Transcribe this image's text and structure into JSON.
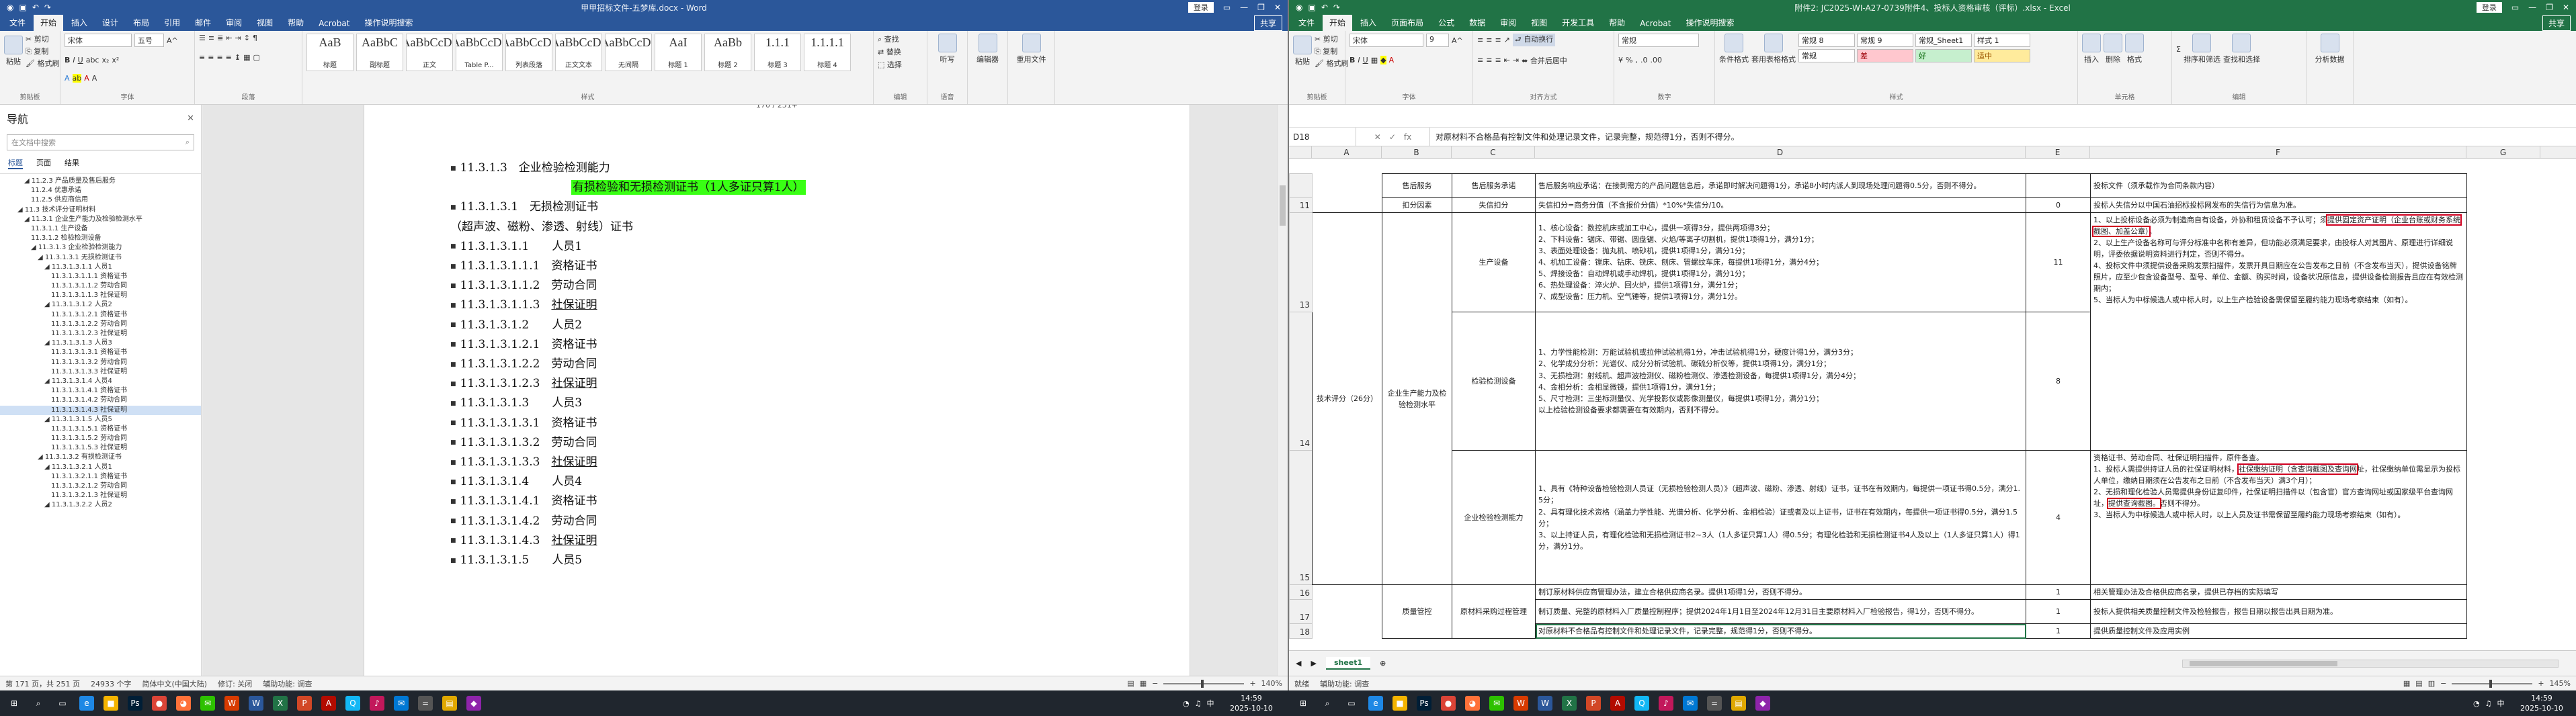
{
  "word": {
    "title": "甲甲招标文件-五梦库.docx - Word",
    "login": "登录",
    "share": "共享",
    "tabs": [
      "文件",
      "开始",
      "插入",
      "设计",
      "布局",
      "引用",
      "邮件",
      "审阅",
      "视图",
      "帮助",
      "Acrobat",
      "操作说明搜索"
    ],
    "ribbon": {
      "paste": "粘贴",
      "cut": "剪切",
      "copy": "复制",
      "format_painter": "格式刷",
      "clipboard": "剪贴板",
      "font_name": "宋体",
      "font_size": "五号",
      "font_group": "字体",
      "para_group": "段落",
      "styles_group": "样式",
      "styles": [
        {
          "sample": "AaB",
          "name": "标题"
        },
        {
          "sample": "AaBbC",
          "name": "副标题"
        },
        {
          "sample": "AaBbCcDc",
          "name": "正文"
        },
        {
          "sample": "AaBbCcDc",
          "name": "Table P..."
        },
        {
          "sample": "AaBbCcDc",
          "name": "列表段落"
        },
        {
          "sample": "AaBbCcDc",
          "name": "正文文本"
        },
        {
          "sample": "AaBbCcDc",
          "name": "无间隔"
        },
        {
          "sample": "AaI",
          "name": "标题 1"
        },
        {
          "sample": "AaBb",
          "name": "标题 2"
        },
        {
          "sample": "1.1.1",
          "name": "标题 3"
        },
        {
          "sample": "1.1.1.1",
          "name": "标题 4"
        }
      ],
      "find": "查找",
      "replace": "替换",
      "select": "选择",
      "edit_group": "编辑",
      "dictate": "听写",
      "voice_group": "语音",
      "editor": "编辑器",
      "reuse": "重用文件"
    },
    "nav": {
      "title": "导航",
      "search_placeholder": "在文档中搜索",
      "tabs": [
        "标题",
        "页面",
        "结果"
      ],
      "items": [
        {
          "indent": 3,
          "text": "◢ 11.2.3 产品质量及售后服务"
        },
        {
          "indent": 4,
          "text": "11.2.4 优惠承诺"
        },
        {
          "indent": 4,
          "text": "11.2.5 供应商信用"
        },
        {
          "indent": 2,
          "text": "◢ 11.3 技术评分证明材料"
        },
        {
          "indent": 3,
          "text": "◢ 11.3.1 企业生产能力及检验检测水平"
        },
        {
          "indent": 4,
          "text": "11.3.1.1 生产设备"
        },
        {
          "indent": 4,
          "text": "11.3.1.2 检验检测设备"
        },
        {
          "indent": 4,
          "text": "◢ 11.3.1.3 企业检验检测能力"
        },
        {
          "indent": 5,
          "text": "◢ 11.3.1.3.1 无损检测证书"
        },
        {
          "indent": 6,
          "text": "◢ 11.3.1.3.1.1 人员1"
        },
        {
          "indent": 7,
          "text": "11.3.1.3.1.1.1 资格证书"
        },
        {
          "indent": 7,
          "text": "11.3.1.3.1.1.2 劳动合同"
        },
        {
          "indent": 7,
          "text": "11.3.1.3.1.1.3 社保证明"
        },
        {
          "indent": 6,
          "text": "◢ 11.3.1.3.1.2 人员2"
        },
        {
          "indent": 7,
          "text": "11.3.1.3.1.2.1 资格证书"
        },
        {
          "indent": 7,
          "text": "11.3.1.3.1.2.2 劳动合同"
        },
        {
          "indent": 7,
          "text": "11.3.1.3.1.2.3 社保证明"
        },
        {
          "indent": 6,
          "text": "◢ 11.3.1.3.1.3 人员3"
        },
        {
          "indent": 7,
          "text": "11.3.1.3.1.3.1 资格证书"
        },
        {
          "indent": 7,
          "text": "11.3.1.3.1.3.2 劳动合同"
        },
        {
          "indent": 7,
          "text": "11.3.1.3.1.3.3 社保证明"
        },
        {
          "indent": 6,
          "text": "◢ 11.3.1.3.1.4 人员4"
        },
        {
          "indent": 7,
          "text": "11.3.1.3.1.4.1 资格证书"
        },
        {
          "indent": 7,
          "text": "11.3.1.3.1.4.2 劳动合同"
        },
        {
          "indent": 7,
          "text": "11.3.1.3.1.4.3 社保证明",
          "sel": true
        },
        {
          "indent": 6,
          "text": "◢ 11.3.1.3.1.5 人员5"
        },
        {
          "indent": 7,
          "text": "11.3.1.3.1.5.1 资格证书"
        },
        {
          "indent": 7,
          "text": "11.3.1.3.1.5.2 劳动合同"
        },
        {
          "indent": 7,
          "text": "11.3.1.3.1.5.3 社保证明"
        },
        {
          "indent": 5,
          "text": "◢ 11.3.1.3.2 有损检测证书"
        },
        {
          "indent": 6,
          "text": "◢ 11.3.1.3.2.1 人员1"
        },
        {
          "indent": 7,
          "text": "11.3.1.3.2.1.1 资格证书"
        },
        {
          "indent": 7,
          "text": "11.3.1.3.2.1.2 劳动合同"
        },
        {
          "indent": 7,
          "text": "11.3.1.3.2.1.3 社保证明"
        },
        {
          "indent": 6,
          "text": "◢ 11.3.1.3.2.2 人员2"
        }
      ]
    },
    "page_number": "170 / 251+",
    "doc_lines": [
      {
        "text": "11.3.1.3　企业检验检测能力",
        "indent": 0
      },
      {
        "text": "有损检验和无损检测证书（1人多证只算1人）",
        "indent": 2,
        "highlight": true,
        "nobullet": true
      },
      {
        "text": "11.3.1.3.1　无损检测证书",
        "indent": 0
      },
      {
        "text": "（超声波、磁粉、渗透、射线）证书",
        "indent": 0,
        "nobullet": true
      },
      {
        "text": "11.3.1.3.1.1　　人员1",
        "indent": 0
      },
      {
        "text": "11.3.1.3.1.1.1　资格证书",
        "indent": 0
      },
      {
        "text": "11.3.1.3.1.1.2　劳动合同",
        "indent": 0
      },
      {
        "text": "11.3.1.3.1.1.3　",
        "indent": 0,
        "u": "社保证明"
      },
      {
        "text": "11.3.1.3.1.2　　人员2",
        "indent": 0
      },
      {
        "text": "11.3.1.3.1.2.1　资格证书",
        "indent": 0
      },
      {
        "text": "11.3.1.3.1.2.2　劳动合同",
        "indent": 0
      },
      {
        "text": "11.3.1.3.1.2.3　",
        "indent": 0,
        "u": "社保证明"
      },
      {
        "text": "11.3.1.3.1.3　　人员3",
        "indent": 0
      },
      {
        "text": "11.3.1.3.1.3.1　资格证书",
        "indent": 0
      },
      {
        "text": "11.3.1.3.1.3.2　劳动合同",
        "indent": 0
      },
      {
        "text": "11.3.1.3.1.3.3　",
        "indent": 0,
        "u": "社保证明"
      },
      {
        "text": "11.3.1.3.1.4　　人员4",
        "indent": 0
      },
      {
        "text": "11.3.1.3.1.4.1　资格证书",
        "indent": 0
      },
      {
        "text": "11.3.1.3.1.4.2　劳动合同",
        "indent": 0
      },
      {
        "text": "11.3.1.3.1.4.3　",
        "indent": 0,
        "u": "社保证明"
      },
      {
        "text": "11.3.1.3.1.5　　人员5",
        "indent": 0
      }
    ],
    "status": {
      "page": "第 171 页，共 251 页",
      "words": "24933 个字",
      "lang": "简体中文(中国大陆)",
      "track": "修订: 关闭",
      "access": "辅助功能: 调查",
      "zoom": "140%"
    }
  },
  "excel": {
    "title": "附件2: JC2025-WI-A27-0739附件4、投标人资格审核（评标）.xlsx - Excel",
    "login": "登录",
    "share": "共享",
    "tabs": [
      "文件",
      "开始",
      "插入",
      "页面布局",
      "公式",
      "数据",
      "审阅",
      "视图",
      "开发工具",
      "帮助",
      "Acrobat",
      "操作说明搜索"
    ],
    "ribbon": {
      "paste": "粘贴",
      "cut": "剪切",
      "copy": "复制",
      "format_painter": "格式刷",
      "clipboard": "剪贴板",
      "font_name": "宋体",
      "font_size": "9",
      "font_group": "字体",
      "wrap": "自动换行",
      "merge": "合并后居中",
      "align_group": "对齐方式",
      "number_format": "常规",
      "number_group": "数字",
      "cond_format": "条件格式",
      "table_format": "套用表格格式",
      "cell_styles": [
        {
          "name": "常规 8",
          "bg": "#ffffff",
          "fg": "#222222"
        },
        {
          "name": "常规 9",
          "bg": "#ffffff",
          "fg": "#222222"
        },
        {
          "name": "常规_Sheet1",
          "bg": "#ffffff",
          "fg": "#222222"
        },
        {
          "name": "样式 1",
          "bg": "#ffffff",
          "fg": "#222222"
        },
        {
          "name": "常规",
          "bg": "#ffffff",
          "fg": "#222222"
        },
        {
          "name": "差",
          "bg": "#ffc7ce",
          "fg": "#9c0006"
        },
        {
          "name": "好",
          "bg": "#c6efce",
          "fg": "#006100"
        },
        {
          "name": "适中",
          "bg": "#ffeb9c",
          "fg": "#9c5700"
        }
      ],
      "styles_group": "样式",
      "insert": "插入",
      "delete": "删除",
      "format": "格式",
      "cells_group": "单元格",
      "sort": "排序和筛选",
      "find": "查找和选择",
      "edit_group": "编辑",
      "ai": "分析数据"
    },
    "name_box": "D18",
    "formula": "对原材料不合格品有控制文件和处理记录文件，记录完整，规范得1分，否则不得分。",
    "columns": [
      "A",
      "B",
      "C",
      "D",
      "E",
      "F",
      "G"
    ],
    "rows": {
      "r10": {
        "num": "",
        "b": "售后服务",
        "c": "售后服务承诺",
        "d": "售后服务响应承诺：在接到需方的产品问题信息后，承诺即时解决问题得1分，承诺8小时内派人到现场处理问题得0.5分，否则不得分。",
        "e": "",
        "f": "投标文件（须承载作为合同条款内容）"
      },
      "r11": {
        "num": "11",
        "b": "扣分因素",
        "c": "失信扣分",
        "d": "失信扣分=商务分值（不含报价分值）*10%*失信分/10。",
        "e": "0",
        "f": "投标人失信分以中国石油招标投标网发布的失信行为信息为准。"
      },
      "r13": {
        "num": "13",
        "c": "生产设备",
        "d": "1、核心设备：数控机床或加工中心，提供一项得3分，提供两项得3分；\n2、下料设备：锯床、带锯、圆盘锯、火焰/等离子切割机，提供1项得1分，满分1分；\n3、表面处理设备：抛丸机、喷砂机，提供1项得1分，满分1分；\n4、机加工设备：镗床、钻床、铣床、刨床、管螺纹车床，每提供1项得1分，满分4分；\n5、焊接设备：自动焊机或手动焊机，提供1项得1分，满分1分；\n6、热处理设备：淬火炉、回火炉，提供1项得1分，满分1分；\n7、成型设备：压力机、空气锤等，提供1项得1分，满分1分。",
        "e": "11",
        "f1": "1、以上投标设备必须为制造商自有设备，外协和租赁设备不予认可；须",
        "f_box1": "提供固定资产证明（企业台账或财务系统截图、加盖公章）",
        "f2": "。\n2、以上生产设备名称可与评分标准中名称有差异，但功能必须满足要求，由投标人对其图片、原理进行详细说明，评委依据说明资料进行判定，否则不得分。"
      },
      "r14": {
        "num": "14",
        "a": "技术评分（26分）",
        "b": "企业生产能力及检验检测水平",
        "c": "检验检测设备",
        "d": "1、力学性能检测：万能试验机或拉伸试验机得1分，冲击试验机得1分，硬度计得1分，满分3分；\n2、化学成分分析：光谱仪、成分分析试验机、碳硫分析仪等，提供1项得1分，满分1分；\n3、无损检测：射线机、超声波检测仪、磁粉检测仪、渗透检测设备，每提供1项得1分，满分4分；\n4、金相分析：金相显微镜，提供1项得1分，满分1分；\n5、尺寸检测：三坐标测量仪、光学投影仪或影像测量仪，每提供1项得1分，满分1分；\n以上检验检测设备要求都需要在有效期内，否则不得分。",
        "e": "8",
        "f": "4、投标文件中须提供设备采购发票扫描件，发票开具日期应在公告发布之日前（不含发布当天），提供设备铭牌照片，应至少包含设备型号、型号、单位、金额、购买时间，设备状况原信息，提供设备检测报告且应在有效检测期内；\n5、当标人为中标候选人或中标人时，以上生产检验设备需保留至履约能力现场考察结束（如有）。"
      },
      "r15": {
        "num": "15",
        "c": "企业检验检测能力",
        "d": "1、具有《特种设备检验检测人员证（无损检验检测人员）》（超声波、磁粉、渗透、射线）证书，证书在有效期内，每提供一项证书得0.5分，满分1.5分；\n2、具有理化技术资格（涵盖力学性能、光谱分析、化学分析、金相检验）证或者及以上证书，证书在有效期内，每提供一项证书得0.5分，满分1.5分；\n3、以上持证人员，有理化检验和无损检测证书2~3人（1人多证只算1人）得0.5分；有理化检验和无损检测证书4人及以上（1人多证只算1人）得1分，满分1分。",
        "e": "4",
        "f1": "资格证书、劳动合同、社保证明扫描件，原件备查。\n1、投标人需提供持证人员的社保证明材料，",
        "f_box1": "社保缴纳证明（含查询截图及查询网",
        "f2": "址，社保缴纳单位需显示为投标人单位，缴纳日期须在公告发布之日前（不含发布当天）满3个月）；\n2、无损和理化检验人员需提供身份证复印件，社保证明扫描件以（包含官）官方查询网址或国家级平台查询网址，",
        "f_box2": "提供查询截图。",
        "f3": "否则不得分。\n3、当标人为中标候选人或中标人时，以上人员及证书需保留至履约能力现场考察结束（如有）。"
      },
      "r16": {
        "num": "16",
        "d": "制订原材料供应商管理办法，建立合格供应商名录。提供1项得1分，否则不得分。",
        "e": "1",
        "f": "相关管理办法及合格供应商名录，提供已存档的实际填写"
      },
      "r17": {
        "num": "17",
        "b": "质量管控",
        "c": "原材料采购过程管理",
        "d": "制订质量、完整的原材料入厂质量控制程序；提供2024年1月1日至2024年12月31日主要原材料入厂检验报告，得1分，否则不得分。",
        "e": "1",
        "f": "投标人提供相关质量控制文件及检验报告，报告日期以报告出具日期为准。"
      },
      "r18": {
        "num": "18",
        "d": "对原材料不合格品有控制文件和处理记录文件，记录完整，规范得1分，否则不得分。",
        "e": "1",
        "f": "提供质量控制文件及应用实例"
      },
      "r19": {
        "num": "19",
        "b": "",
        "c": "",
        "d": "",
        "e": "",
        "f": ""
      }
    },
    "sheet_tab": "sheet1",
    "status": {
      "ready": "就绪",
      "access": "辅助功能: 调查",
      "zoom": "145%"
    }
  },
  "taskbar": {
    "search": "搜索",
    "time": "14:59",
    "date": "2025-10-10",
    "lang": "中",
    "icons": [
      {
        "name": "start-icon",
        "glyph": "⊞",
        "bg": "#20262e"
      },
      {
        "name": "search-icon",
        "glyph": "⌕",
        "bg": "#20262e"
      },
      {
        "name": "task-view-icon",
        "glyph": "▭",
        "bg": "#20262e"
      },
      {
        "name": "edge-icon",
        "glyph": "e",
        "bg": "#1e88e5"
      },
      {
        "name": "explorer-icon",
        "glyph": "■",
        "bg": "#f4b400"
      },
      {
        "name": "photoshop-icon",
        "glyph": "Ps",
        "bg": "#001e36"
      },
      {
        "name": "chrome-icon",
        "glyph": "●",
        "bg": "#db4437"
      },
      {
        "name": "firefox-icon",
        "glyph": "◕",
        "bg": "#ff7139"
      },
      {
        "name": "wechat-icon",
        "glyph": "✉",
        "bg": "#2dc100"
      },
      {
        "name": "wps-icon",
        "glyph": "W",
        "bg": "#d83b01"
      },
      {
        "name": "word-icon",
        "glyph": "W",
        "bg": "#2b579a"
      },
      {
        "name": "excel-icon",
        "glyph": "X",
        "bg": "#217346"
      },
      {
        "name": "powerpoint-icon",
        "glyph": "P",
        "bg": "#d24726"
      },
      {
        "name": "acrobat-icon",
        "glyph": "A",
        "bg": "#b30b00"
      },
      {
        "name": "qq-icon",
        "glyph": "Q",
        "bg": "#12b7f5"
      },
      {
        "name": "music-icon",
        "glyph": "♪",
        "bg": "#c2185b"
      },
      {
        "name": "mail-icon",
        "glyph": "✉",
        "bg": "#0078d4"
      },
      {
        "name": "calc-icon",
        "glyph": "=",
        "bg": "#555555"
      },
      {
        "name": "folder-icon",
        "glyph": "▤",
        "bg": "#e0a800"
      },
      {
        "name": "app-icon",
        "glyph": "◆",
        "bg": "#8e24aa"
      }
    ]
  }
}
